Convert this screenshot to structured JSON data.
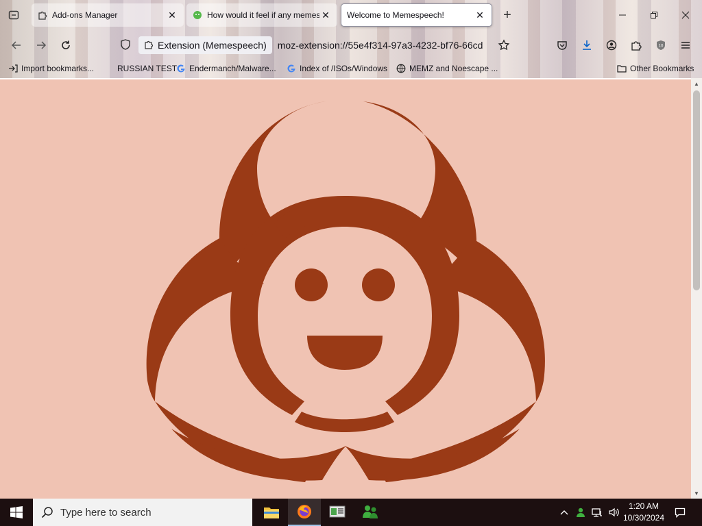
{
  "browser": {
    "tabs": [
      {
        "label": "Add-ons Manager",
        "state": "inactive",
        "icon": "puzzle-icon"
      },
      {
        "label": "How would it feel if any memes",
        "state": "inactive",
        "icon": "meme-favicon"
      },
      {
        "label": "Welcome to Memespeech!",
        "state": "active",
        "icon": ""
      }
    ],
    "new_tab_label": "+",
    "identity_label": "Extension (Memespeech)",
    "url": "moz-extension://55e4f314-97a3-4232-bf76-66cd",
    "bookmarks": [
      {
        "label": "Import bookmarks...",
        "icon": "import-icon"
      },
      {
        "label": "RUSSIAN TEST",
        "icon": ""
      },
      {
        "label": "Endermanch/Malware...",
        "icon": "google-icon"
      },
      {
        "label": "Index of /ISOs/Windows",
        "icon": "google-icon"
      },
      {
        "label": "MEMZ and Noescape ...",
        "icon": "globe-icon"
      }
    ],
    "other_bookmarks": "Other Bookmarks"
  },
  "page": {
    "background_color": "#f0c3b3",
    "symbol_color": "#9a3a16",
    "symbol": "biohazard-smiley-icon"
  },
  "taskbar": {
    "search_placeholder": "Type here to search",
    "time": "1:20 AM",
    "date": "10/30/2024"
  }
}
